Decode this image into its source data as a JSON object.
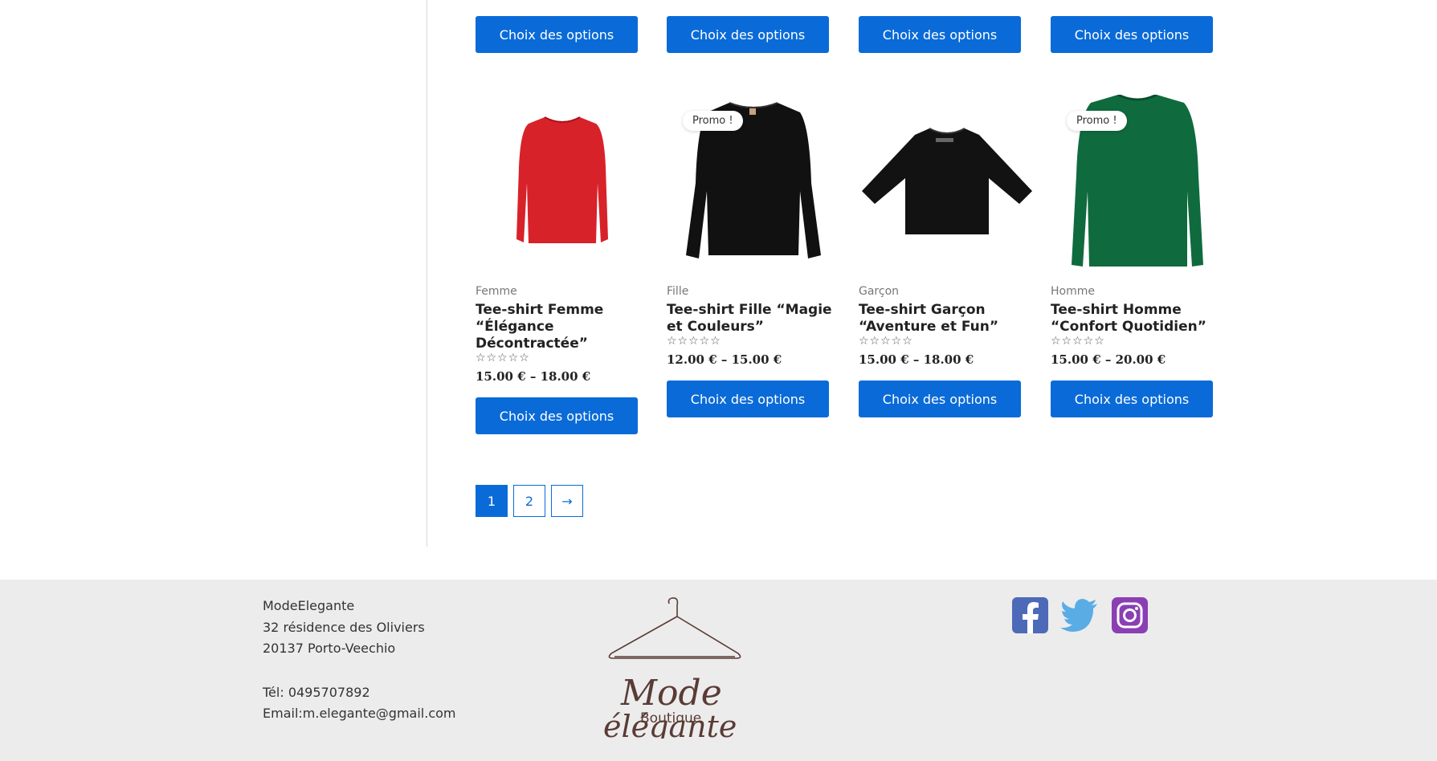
{
  "buttons": {
    "choose_options": "Choix des options"
  },
  "products": [
    {
      "category": "Femme",
      "title": "Tee-shirt Femme “Élégance Décontractée”",
      "rating": "☆☆☆☆☆",
      "price": "15.00 € – 18.00 €",
      "badge": "",
      "color": "#d8222a"
    },
    {
      "category": "Fille",
      "title": "Tee-shirt Fille “Magie et Couleurs”",
      "rating": "☆☆☆☆☆",
      "price": "12.00 € – 15.00 €",
      "badge": "Promo !",
      "color": "#111111"
    },
    {
      "category": "Garçon",
      "title": "Tee-shirt Garçon “Aventure et Fun”",
      "rating": "☆☆☆☆☆",
      "price": "15.00 € – 18.00 €",
      "badge": "",
      "color": "#121212"
    },
    {
      "category": "Homme",
      "title": "Tee-shirt Homme “Confort Quotidien”",
      "rating": "☆☆☆☆☆",
      "price": "15.00 € – 20.00 €",
      "badge": "Promo !",
      "color": "#0f6b3e"
    }
  ],
  "pagination": {
    "pages": [
      "1",
      "2"
    ],
    "next": "→",
    "current": "1"
  },
  "footer": {
    "company": "ModeElegante",
    "address_line1": "32 résidence des Oliviers",
    "address_line2": "20137 Porto-Veechio",
    "phone": "Tél: 0495707892",
    "email": "Email:m.elegante@gmail.com",
    "logo_text_main": "Mode",
    "logo_text_sub": "Boutique",
    "logo_text_script": "élégante",
    "social": {
      "facebook_color": "#4d6ab8",
      "twitter_color": "#5aace5",
      "instagram_color": "#8a3fb4"
    }
  },
  "colors": {
    "accent": "#0a6bd8",
    "footer_bg": "#ececec"
  }
}
